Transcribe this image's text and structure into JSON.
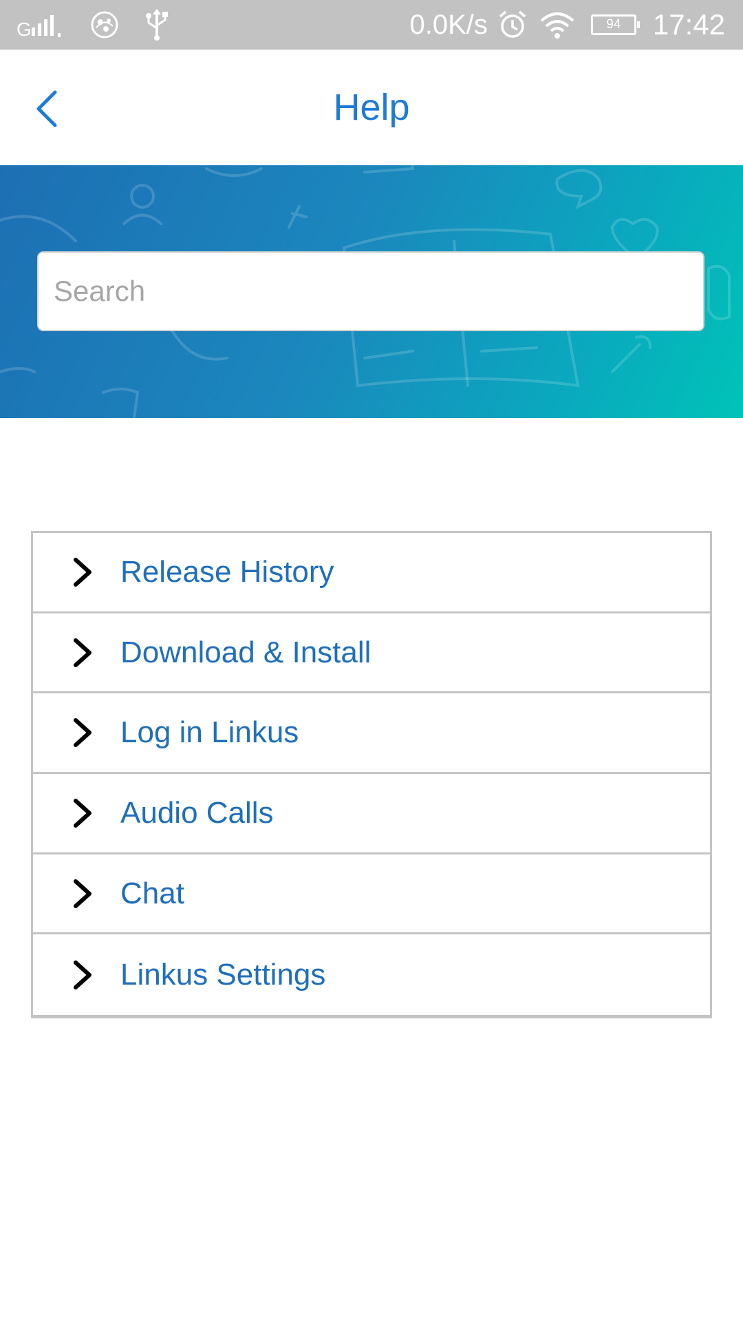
{
  "status_bar": {
    "network_speed": "0.0K/s",
    "battery_level": "94",
    "time": "17:42",
    "icons": [
      "signal-icon",
      "app-notification-icon",
      "usb-icon",
      "alarm-icon",
      "wifi-icon",
      "battery-icon"
    ]
  },
  "header": {
    "title": "Help",
    "back_icon": "chevron-left-icon"
  },
  "search": {
    "placeholder": "Search",
    "value": ""
  },
  "topics": {
    "items": [
      {
        "label": "Release History"
      },
      {
        "label": "Download & Install"
      },
      {
        "label": "Log in Linkus"
      },
      {
        "label": "Audio Calls"
      },
      {
        "label": "Chat"
      },
      {
        "label": "Linkus Settings"
      }
    ],
    "icon": "chevron-right-icon"
  },
  "colors": {
    "accent": "#1e7bd6",
    "topic_text": "#1f6fbb",
    "status_bar_bg": "#c2c2c2",
    "banner_gradient_start": "#1d6fb3",
    "banner_gradient_end": "#00c3b8",
    "row_border": "#c4c4c4"
  }
}
